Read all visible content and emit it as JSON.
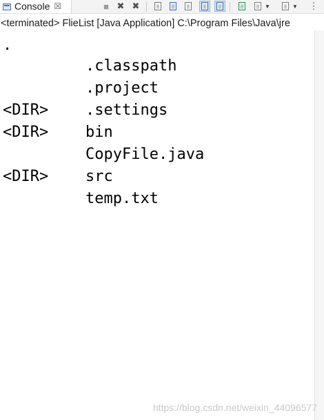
{
  "tab": {
    "label": "Console",
    "close_symbol": "☒"
  },
  "toolbar": {
    "buttons": [
      {
        "name": "terminate-button",
        "icon": "stop-icon",
        "symbol": "■"
      },
      {
        "name": "remove-launch-button",
        "icon": "remove-icon",
        "symbol": "✖"
      },
      {
        "name": "remove-all-button",
        "icon": "remove-all-icon",
        "symbol": "✖"
      },
      {
        "name": "clear-console-button",
        "icon": "clear-console-icon"
      },
      {
        "name": "scroll-lock-button",
        "icon": "scroll-lock-icon"
      },
      {
        "name": "word-wrap-button",
        "icon": "word-wrap-icon"
      },
      {
        "name": "show-on-stdout-button",
        "icon": "show-stdout-icon"
      },
      {
        "name": "show-on-stderr-button",
        "icon": "show-stderr-icon"
      },
      {
        "name": "pin-console-button",
        "icon": "pin-icon"
      },
      {
        "name": "display-console-button",
        "icon": "display-console-icon"
      },
      {
        "name": "open-console-button",
        "icon": "open-console-icon"
      },
      {
        "name": "view-menu-button",
        "icon": "view-menu-icon",
        "symbol": "⋮"
      }
    ]
  },
  "status": {
    "text": "<terminated> FlieList [Java Application] C:\\Program Files\\Java\\jre"
  },
  "console": {
    "lines": [
      {
        "tag": ".",
        "name": ""
      },
      {
        "tag": "",
        "name": ".classpath"
      },
      {
        "tag": "",
        "name": ".project"
      },
      {
        "tag": "<DIR>",
        "name": ".settings"
      },
      {
        "tag": "<DIR>",
        "name": "bin"
      },
      {
        "tag": "",
        "name": "CopyFile.java"
      },
      {
        "tag": "<DIR>",
        "name": "src"
      },
      {
        "tag": "",
        "name": "temp.txt"
      }
    ]
  },
  "watermark": "https://blog.csdn.net/weixin_44096577",
  "colors": {
    "text": "#000000",
    "background": "#ffffff",
    "active_toggle": "#cfe0f5"
  }
}
